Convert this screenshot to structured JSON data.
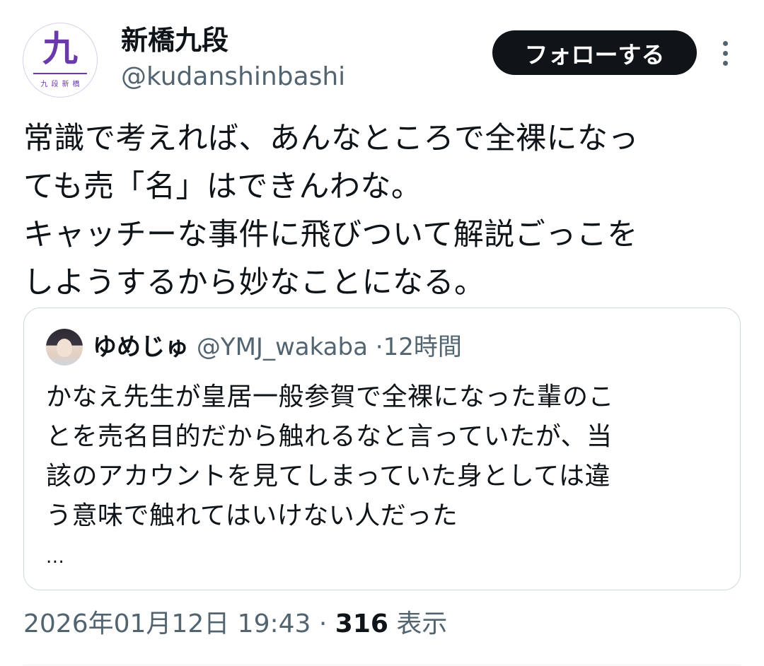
{
  "author": {
    "display_name": "新橋九段",
    "handle": "@kudanshinbashi",
    "avatar_glyph": "九",
    "avatar_subtext": "九段新橋",
    "avatar_color": "#6a3aa8"
  },
  "follow_button": {
    "label": "フォローする"
  },
  "more_icon": "more-vertical-icon",
  "tweet": {
    "lines": [
      "常識で考えれば、あんなところで全裸になっ",
      "ても売「名」はできんわな。",
      "キャッチーな事件に飛びついて解説ごっこを",
      "しようするから妙なことになる。"
    ]
  },
  "quote": {
    "display_name": "ゆめじゅ",
    "handle": "@YMJ_wakaba",
    "separator": "·",
    "time_ago": "12時間",
    "lines": [
      "かなえ先生が皇居一般参賀で全裸になった輩のこ",
      "とを売名目的だから触れるなと言っていたが、当",
      "該のアカウントを見てしまっていた身としては違",
      "う意味で触れてはいけない人だった"
    ],
    "ellipsis": "..."
  },
  "meta": {
    "timestamp": "2026年01月12日 19:43",
    "separator": "·",
    "views_count": "316",
    "views_label": "表示"
  },
  "colors": {
    "text_primary": "#0f1419",
    "text_secondary": "#536471",
    "border": "#cfd9de",
    "button_bg": "#0f1419"
  }
}
